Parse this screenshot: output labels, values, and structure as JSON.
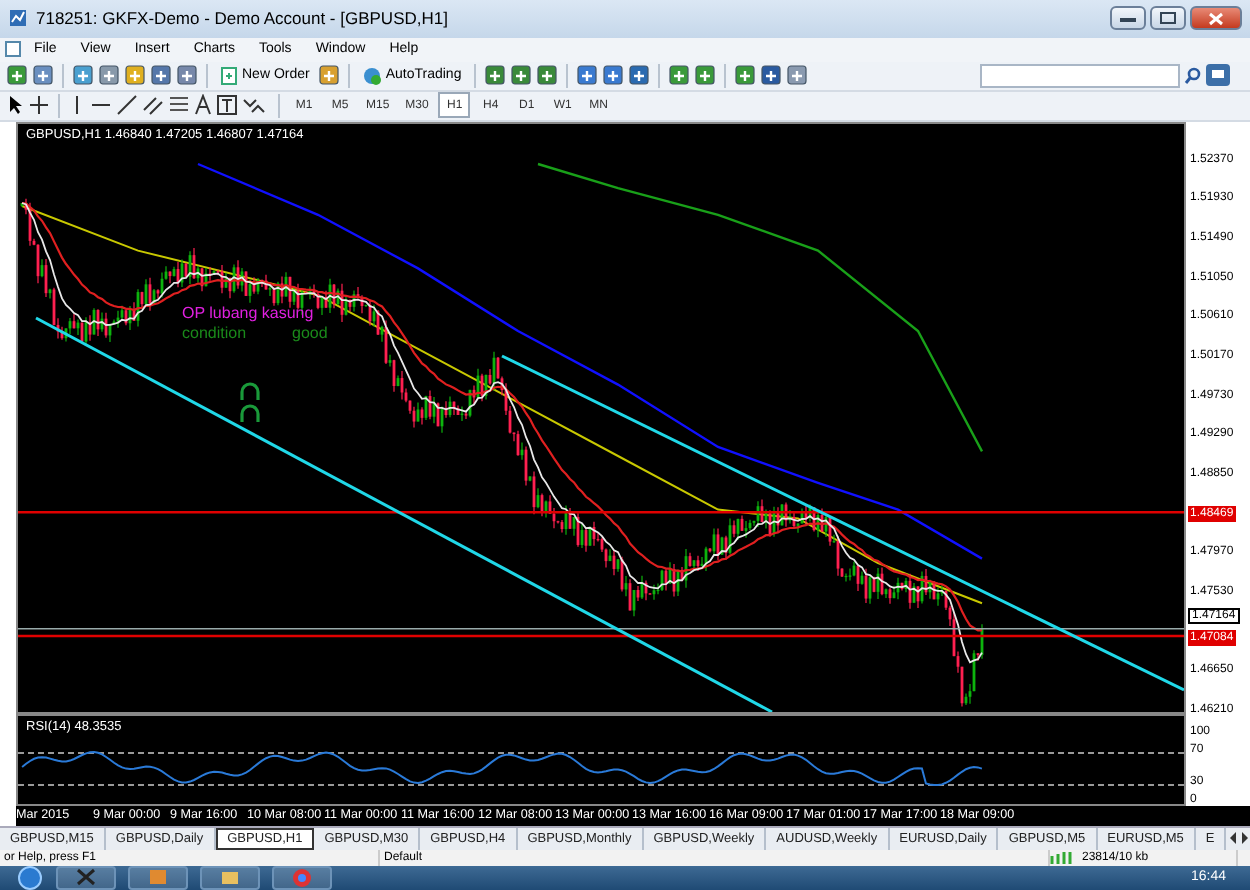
{
  "window": {
    "title": "718251: GKFX-Demo - Demo Account - [GBPUSD,H1]"
  },
  "menu": [
    "File",
    "View",
    "Insert",
    "Charts",
    "Tools",
    "Window",
    "Help"
  ],
  "toolbar": {
    "new_order": "New Order",
    "autotrading": "AutoTrading"
  },
  "timeframes": [
    {
      "label": "M1",
      "selected": false
    },
    {
      "label": "M5",
      "selected": false
    },
    {
      "label": "M15",
      "selected": false
    },
    {
      "label": "M30",
      "selected": false
    },
    {
      "label": "H1",
      "selected": true
    },
    {
      "label": "H4",
      "selected": false
    },
    {
      "label": "D1",
      "selected": false
    },
    {
      "label": "W1",
      "selected": false
    },
    {
      "label": "MN",
      "selected": false
    }
  ],
  "chart": {
    "header": "GBPUSD,H1  1.46840 1.47205 1.46807 1.47164",
    "notes": [
      {
        "text": "OP lubang kasung",
        "color": "#e020e0"
      },
      {
        "text": "condition",
        "color": "#1a8a1a"
      },
      {
        "text": "good",
        "color": "#1a8a1a"
      }
    ],
    "price_labels": [
      {
        "text": "1.52370",
        "kind": "plain"
      },
      {
        "text": "1.51930",
        "kind": "plain"
      },
      {
        "text": "1.51490",
        "kind": "plain"
      },
      {
        "text": "1.51050",
        "kind": "plain"
      },
      {
        "text": "1.50610",
        "kind": "plain"
      },
      {
        "text": "1.50170",
        "kind": "plain"
      },
      {
        "text": "1.49730",
        "kind": "plain"
      },
      {
        "text": "1.49290",
        "kind": "plain"
      },
      {
        "text": "1.48850",
        "kind": "plain"
      },
      {
        "text": "1.48469",
        "kind": "line"
      },
      {
        "text": "1.47970",
        "kind": "plain"
      },
      {
        "text": "1.47530",
        "kind": "plain"
      },
      {
        "text": "1.47164",
        "kind": "bid"
      },
      {
        "text": "1.47084",
        "kind": "line"
      },
      {
        "text": "1.46650",
        "kind": "plain"
      },
      {
        "text": "1.46210",
        "kind": "plain"
      }
    ]
  },
  "rsi": {
    "label": "RSI(14) 48.3535",
    "scale": [
      "100",
      "70",
      "30",
      "0"
    ]
  },
  "time_axis": [
    "Mar 2015",
    "9 Mar 00:00",
    "9 Mar 16:00",
    "10 Mar 08:00",
    "11 Mar 00:00",
    "11 Mar 16:00",
    "12 Mar 08:00",
    "13 Mar 00:00",
    "13 Mar 16:00",
    "16 Mar 09:00",
    "17 Mar 01:00",
    "17 Mar 17:00",
    "18 Mar 09:00"
  ],
  "tabs": [
    {
      "label": "GBPUSD,M15",
      "selected": false
    },
    {
      "label": "GBPUSD,Daily",
      "selected": false
    },
    {
      "label": "GBPUSD,H1",
      "selected": true
    },
    {
      "label": "GBPUSD,M30",
      "selected": false
    },
    {
      "label": "GBPUSD,H4",
      "selected": false
    },
    {
      "label": "GBPUSD,Monthly",
      "selected": false
    },
    {
      "label": "GBPUSD,Weekly",
      "selected": false
    },
    {
      "label": "AUDUSD,Weekly",
      "selected": false
    },
    {
      "label": "EURUSD,Daily",
      "selected": false
    },
    {
      "label": "GBPUSD,M5",
      "selected": false
    },
    {
      "label": "EURUSD,M5",
      "selected": false
    },
    {
      "label": "E",
      "selected": false
    }
  ],
  "status_bar": [
    "or Help, press F1",
    "Default",
    "23814/10 kb"
  ],
  "taskbar": {
    "time": "16:44"
  }
}
